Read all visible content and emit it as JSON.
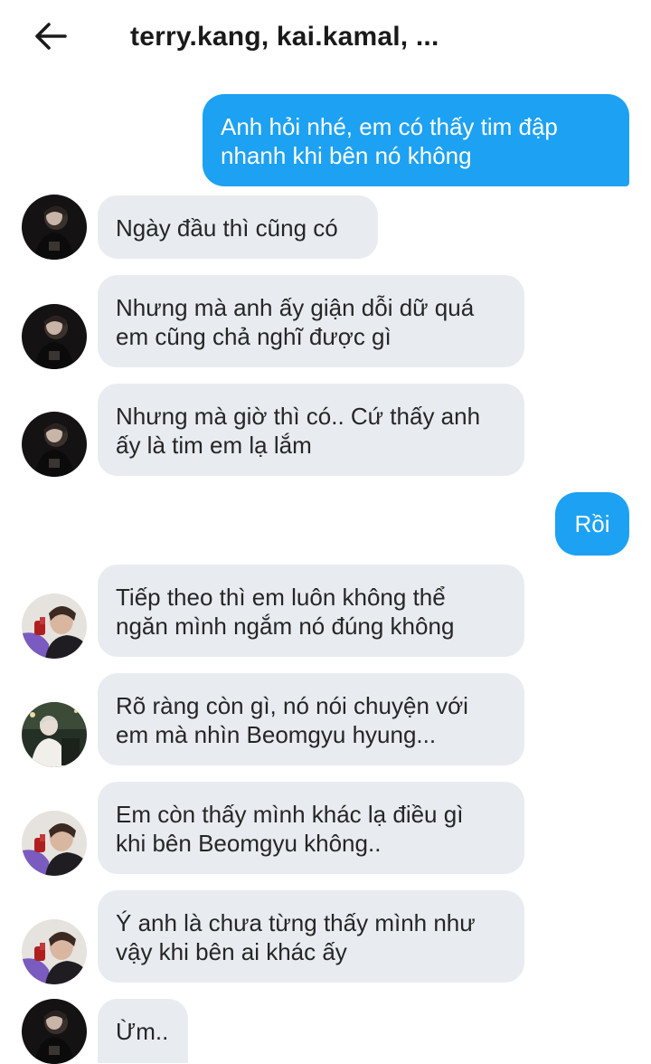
{
  "header": {
    "title": "terry.kang, kai.kamal, ..."
  },
  "messages": [
    {
      "side": "out",
      "text": "Anh hỏi nhé, em có thấy tim đập\nnhanh khi bên nó không"
    },
    {
      "side": "in",
      "avatar": "avatar-dark",
      "text": "Ngày đầu thì cũng có"
    },
    {
      "side": "in",
      "avatar": "avatar-dark",
      "text": "Nhưng mà anh ấy giận dỗi dữ quá\nem cũng chả nghĩ được gì"
    },
    {
      "side": "in",
      "avatar": "avatar-dark",
      "text": "Nhưng mà giờ thì có.. Cứ thấy anh\nấy là tim em lạ lắm"
    },
    {
      "side": "out",
      "text": "Rồi"
    },
    {
      "side": "in",
      "avatar": "avatar-purple",
      "text": "Tiếp theo thì em luôn không thể\nngăn mình ngắm nó đúng không"
    },
    {
      "side": "in",
      "avatar": "avatar-outdoor",
      "text": "Rõ ràng còn gì, nó nói chuyện với\nem mà nhìn Beomgyu hyung..."
    },
    {
      "side": "in",
      "avatar": "avatar-purple",
      "text": "Em còn thấy mình khác lạ điều gì\nkhi bên Beomgyu không.."
    },
    {
      "side": "in",
      "avatar": "avatar-purple",
      "text": "Ý anh là chưa từng thấy mình như\nvậy khi bên ai khác ấy"
    },
    {
      "side": "in",
      "avatar": "avatar-dark",
      "text": "Ừm.."
    }
  ],
  "icons": {
    "back": "arrow-left-icon"
  },
  "colors": {
    "outgoing_bubble": "#1da1f2",
    "incoming_bubble": "#e8ecf0",
    "background": "#ffffff"
  }
}
